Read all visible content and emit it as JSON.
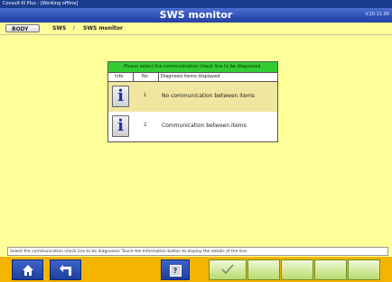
{
  "window": {
    "titlebar_text": "Consult-III Plus - [Working offline]",
    "title": "SWS monitor",
    "version": "V.20.11.00"
  },
  "breadcrumb": {
    "items": [
      "BODY",
      "SWS",
      "SWS monitor"
    ],
    "separator": "/"
  },
  "panel": {
    "header": "Please select the communication check line to be diagnosed.",
    "columns": [
      "Info",
      "No",
      "Diagnosis items displayed"
    ],
    "rows": [
      {
        "no": "1",
        "description": "No communication between items"
      },
      {
        "no": "2",
        "description": "Communication between items"
      }
    ]
  },
  "status_text": "Select the communication check line to be diagnosed. Touch the Information button to display the details of the line.",
  "toolbar": {
    "home_icon": "home-icon",
    "back_icon": "return-icon",
    "help_label": "?",
    "ok_icon": "check-icon"
  },
  "colors": {
    "background": "#ffff99",
    "header_blue": "#2f4fb5",
    "table_header_green": "#33cc33",
    "toolbar_orange": "#f5b400"
  }
}
